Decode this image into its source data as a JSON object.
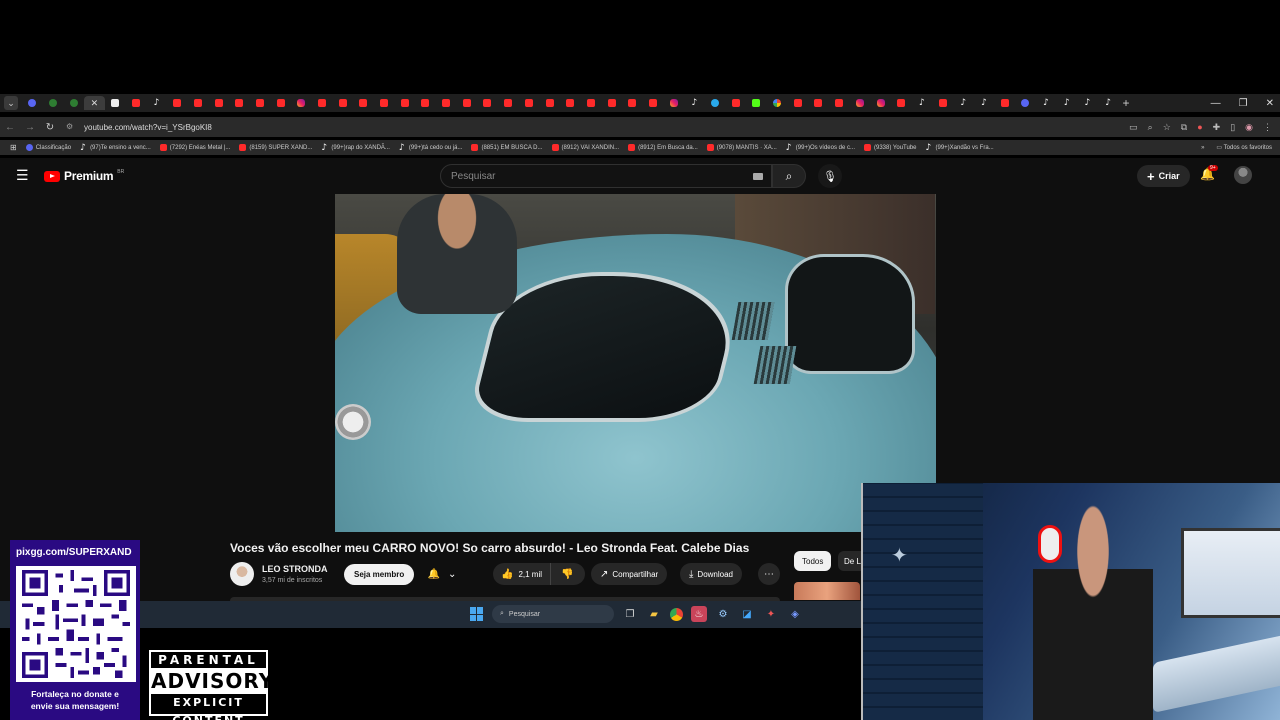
{
  "browser": {
    "tab_favicons": [
      "dc",
      "gr",
      "gr",
      "cl",
      "wt",
      "yt",
      "tk",
      "yt",
      "yt",
      "yt",
      "yt",
      "yt",
      "yt",
      "ig",
      "yt",
      "yt",
      "yt",
      "yt",
      "yt",
      "yt",
      "yt",
      "yt",
      "yt",
      "yt",
      "yt",
      "yt",
      "yt",
      "yt",
      "yt",
      "yt",
      "yt",
      "ig",
      "tk",
      "tg",
      "yt",
      "kk",
      "gg",
      "yt",
      "yt",
      "yt",
      "ig",
      "ig",
      "yt",
      "tk",
      "yt",
      "tk",
      "tk",
      "yt",
      "dc",
      "tk",
      "tk",
      "tk",
      "tk"
    ],
    "new_tab": "+",
    "url": "youtube.com/watch?v=i_YSrBgoKI8",
    "bookmarks": [
      {
        "icon": "dc",
        "label": "Classificação"
      },
      {
        "icon": "tk",
        "label": "(97)Te ensino a venc..."
      },
      {
        "icon": "yt",
        "label": "(7292) Enéas Metal |..."
      },
      {
        "icon": "yt",
        "label": "(8159) SUPER XAND..."
      },
      {
        "icon": "tk",
        "label": "(99+)rap do XANDÃ..."
      },
      {
        "icon": "tk",
        "label": "(99+)tá cedo ou já..."
      },
      {
        "icon": "yt",
        "label": "(8851) EM BUSCA D..."
      },
      {
        "icon": "yt",
        "label": "(8912) VAI XANDIN..."
      },
      {
        "icon": "yt",
        "label": "(8912) Em Busca da..."
      },
      {
        "icon": "yt",
        "label": "(9078) MANTIS · XA..."
      },
      {
        "icon": "tk",
        "label": "(99+)Os vídeos de c..."
      },
      {
        "icon": "yt",
        "label": "(9338) YouTube"
      },
      {
        "icon": "tk",
        "label": "(99+)Xandão vs Fra..."
      }
    ],
    "all_bookmarks": "Todos os favoritos"
  },
  "youtube": {
    "logo_text": "Premium",
    "country": "BR",
    "search_placeholder": "Pesquisar",
    "create_label": "Criar",
    "notif_badge": "9+",
    "video": {
      "title": "Voces vão escolher meu CARRO NOVO! So carro absurdo! - Leo Stronda Feat. Calebe Dias",
      "channel": "LEO STRONDA",
      "subscribers": "3,57 mi de inscritos",
      "member_label": "Seja membro",
      "likes": "2,1 mil",
      "share_label": "Compartilhar",
      "download_label": "Download"
    },
    "chips": [
      "Todos",
      "De L"
    ]
  },
  "taskbar": {
    "search_label": "Pesquisar"
  },
  "overlay": {
    "qr_url": "pixgg.com/SUPERXAND",
    "qr_text_line1": "Fortaleça no donate e",
    "qr_text_line2": "envie sua mensagem!",
    "advisory_top": "PARENTAL",
    "advisory_mid": "ADVISORY",
    "advisory_bot": "EXPLICIT CONTENT"
  },
  "colors": {
    "youtube_red": "#ff0000",
    "qr_panel": "#2a0a82",
    "page_bg": "#0f0f0f"
  }
}
